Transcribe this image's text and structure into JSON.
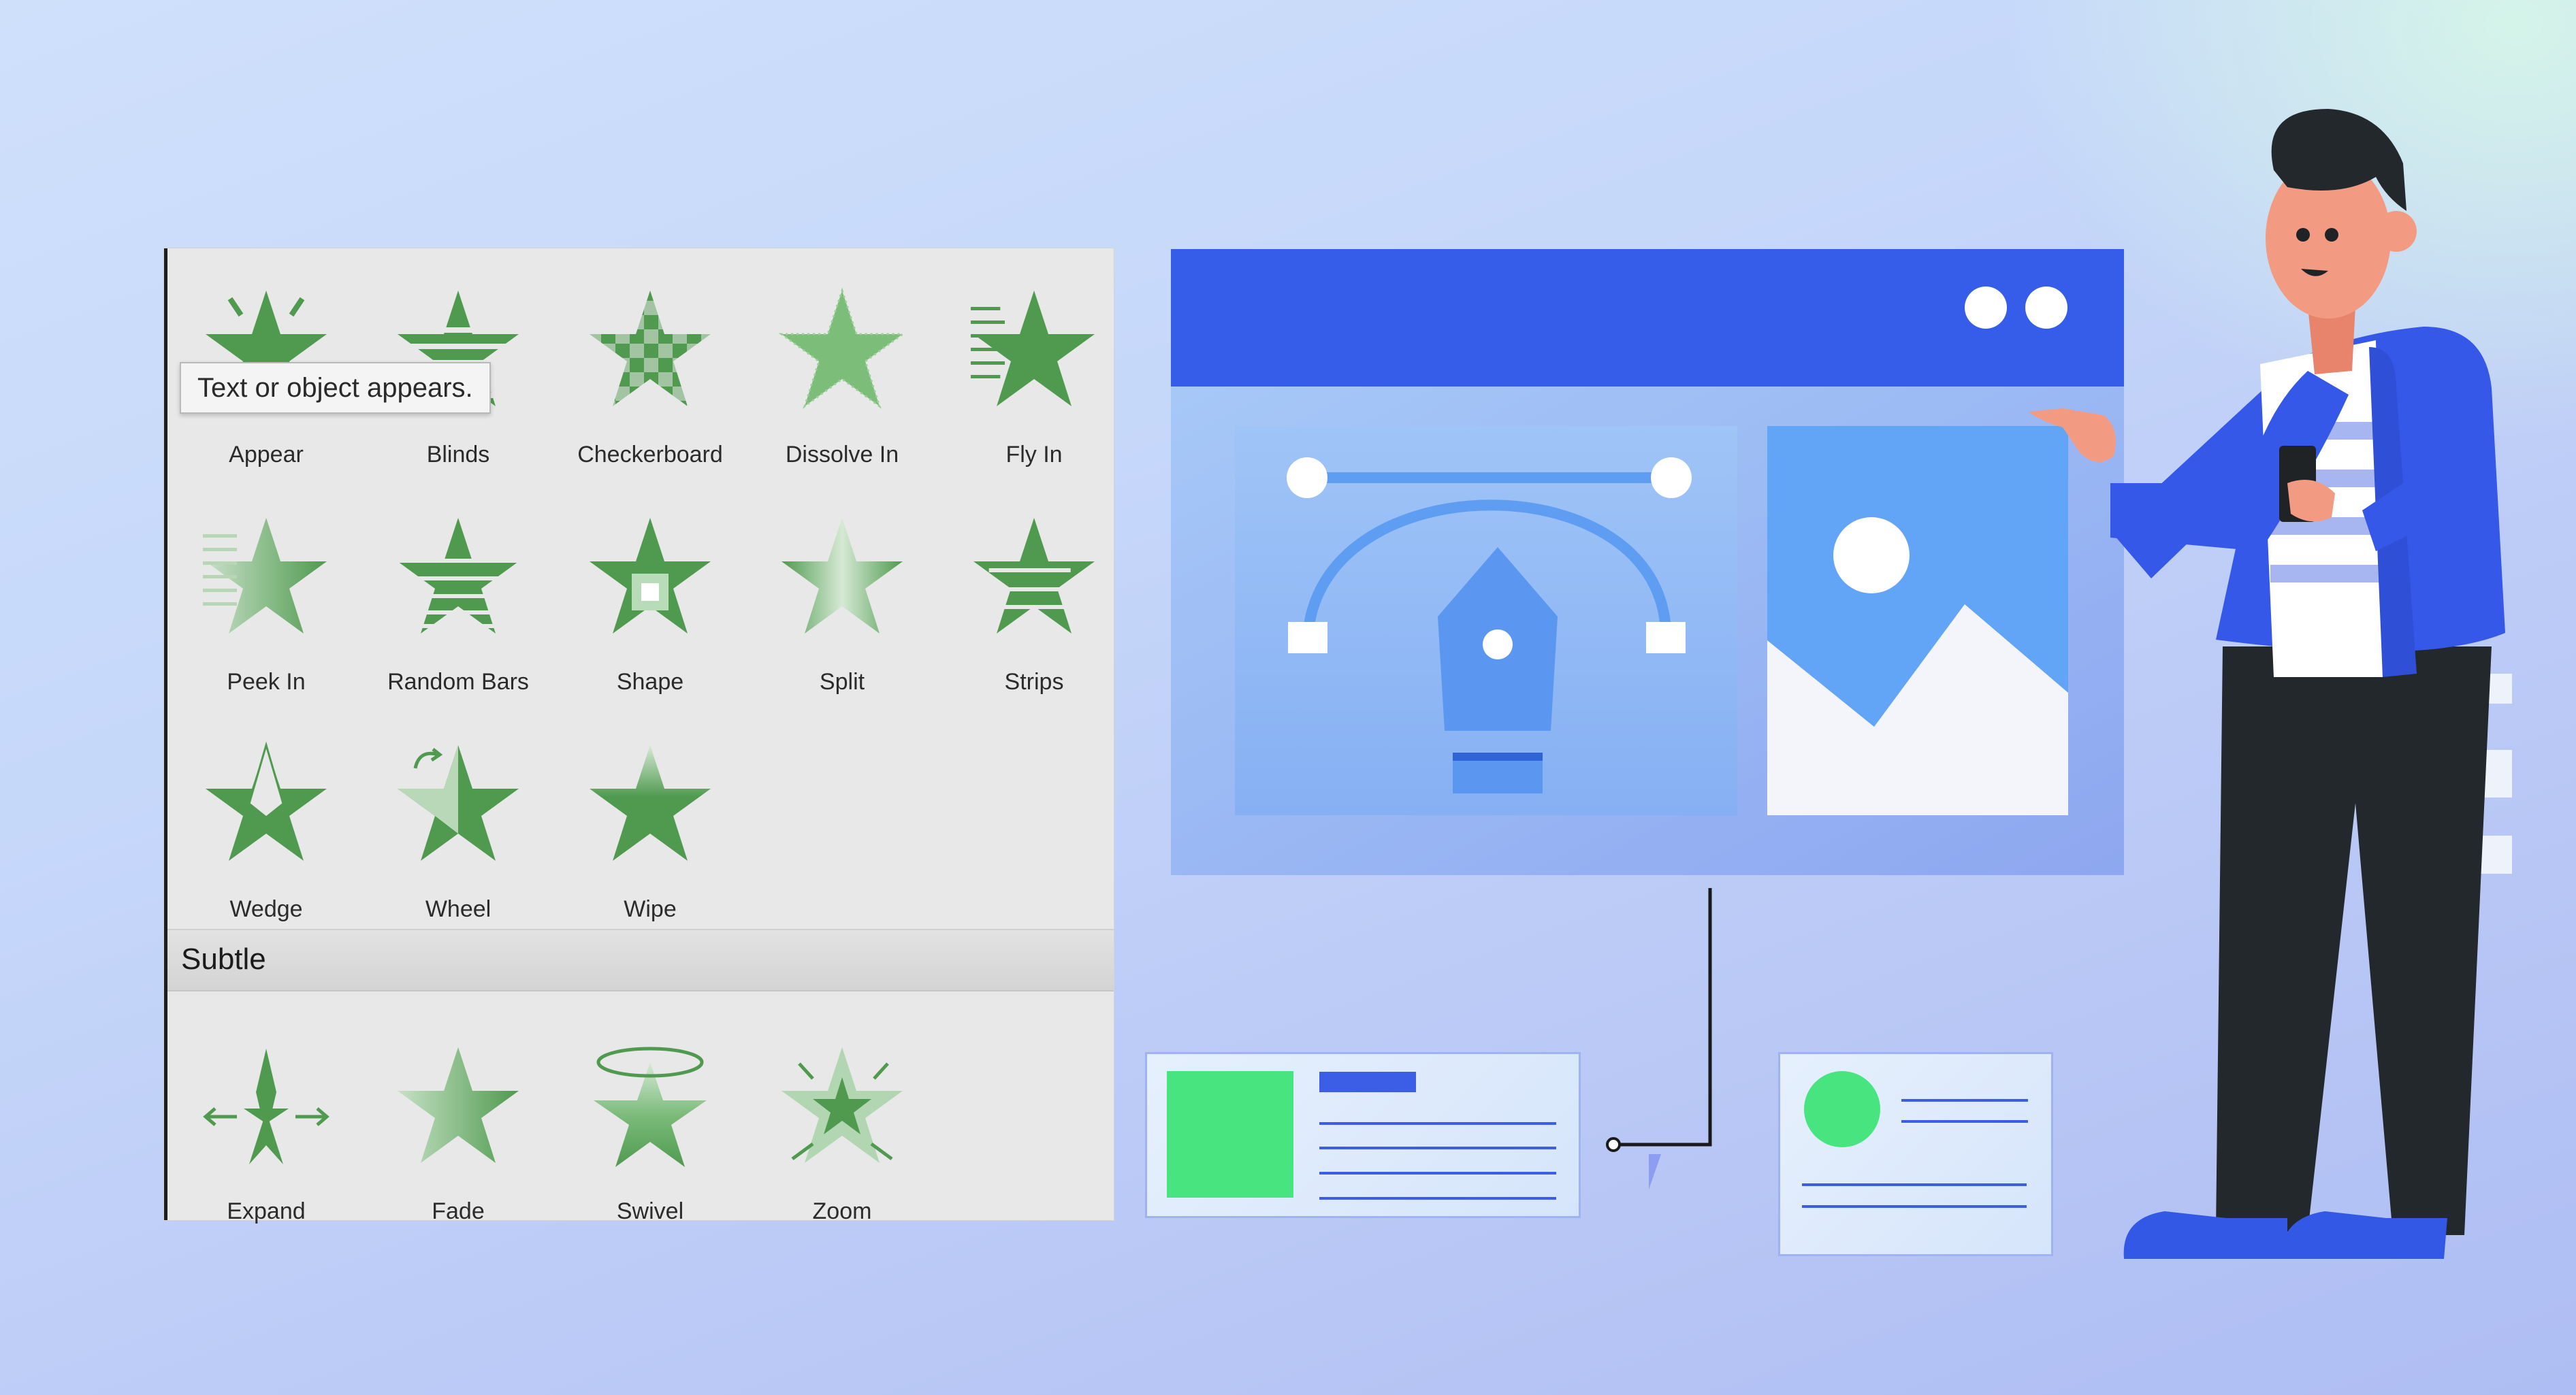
{
  "tooltip": "Text or object appears.",
  "effects_entrance": [
    {
      "label": "Appear",
      "icon": "appear-icon"
    },
    {
      "label": "Blinds",
      "icon": "blinds-icon"
    },
    {
      "label": "Checkerboard",
      "icon": "checkerboard-icon"
    },
    {
      "label": "Dissolve In",
      "icon": "dissolve-in-icon"
    },
    {
      "label": "Fly In",
      "icon": "fly-in-icon"
    },
    {
      "label": "Peek In",
      "icon": "peek-in-icon"
    },
    {
      "label": "Random Bars",
      "icon": "random-bars-icon"
    },
    {
      "label": "Shape",
      "icon": "shape-icon"
    },
    {
      "label": "Split",
      "icon": "split-icon"
    },
    {
      "label": "Strips",
      "icon": "strips-icon"
    },
    {
      "label": "Wedge",
      "icon": "wedge-icon"
    },
    {
      "label": "Wheel",
      "icon": "wheel-icon"
    },
    {
      "label": "Wipe",
      "icon": "wipe-icon"
    }
  ],
  "section_subtle": "Subtle",
  "effects_subtle": [
    {
      "label": "Expand",
      "icon": "expand-icon"
    },
    {
      "label": "Fade",
      "icon": "fade-icon"
    },
    {
      "label": "Swivel",
      "icon": "swivel-icon"
    },
    {
      "label": "Zoom",
      "icon": "zoom-icon"
    }
  ],
  "colors": {
    "star_green": "#4f9a4f",
    "browser_bar": "#365de9",
    "accent_green": "#47e47f"
  }
}
